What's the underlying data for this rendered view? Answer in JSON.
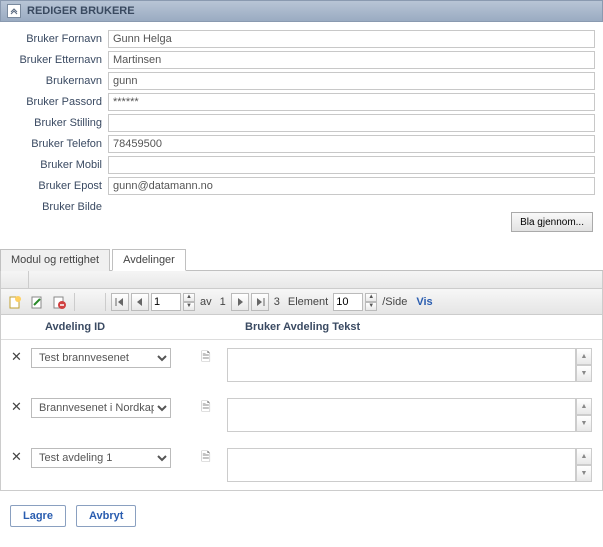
{
  "panel": {
    "title": "REDIGER BRUKERE"
  },
  "form": {
    "labels": {
      "fornavn": "Bruker Fornavn",
      "etternavn": "Bruker Etternavn",
      "brukernavn": "Brukernavn",
      "passord": "Bruker Passord",
      "stilling": "Bruker Stilling",
      "telefon": "Bruker Telefon",
      "mobil": "Bruker Mobil",
      "epost": "Bruker Epost",
      "bilde": "Bruker Bilde"
    },
    "values": {
      "fornavn": "Gunn Helga",
      "etternavn": "Martinsen",
      "brukernavn": "gunn",
      "passord": "******",
      "stilling": "",
      "telefon": "78459500",
      "mobil": "",
      "epost": "gunn@datamann.no"
    },
    "browse_label": "Bla gjennom..."
  },
  "tabs": {
    "items": [
      "Modul og rettighet",
      "Avdelinger"
    ],
    "active_index": 1
  },
  "pager": {
    "page": "1",
    "av": "av",
    "total_pages": "1",
    "element_label": "Element",
    "element_count": "3",
    "per_page": "10",
    "per_side": "/Side",
    "vis": "Vis"
  },
  "grid": {
    "headers": {
      "col1": "Avdeling ID",
      "col2": "Bruker Avdeling Tekst"
    },
    "rows": [
      {
        "dept": "Test brannvesenet"
      },
      {
        "dept": "Brannvesenet i Nordkapp"
      },
      {
        "dept": "Test avdeling 1"
      }
    ]
  },
  "footer": {
    "save": "Lagre",
    "cancel": "Avbryt"
  },
  "icons": {
    "collapse": "⌃",
    "first": "|◀",
    "prev": "◀",
    "next": "▶",
    "last": "▶|",
    "up": "▲",
    "down": "▼",
    "delete": "✕",
    "note": "🗎"
  }
}
